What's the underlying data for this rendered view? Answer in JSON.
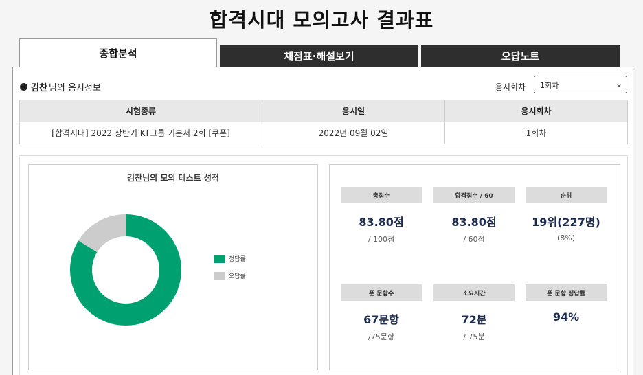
{
  "page_title": "합격시대 모의고사 결과표",
  "tabs": [
    {
      "label": "종합분석"
    },
    {
      "label": "채점표·해설보기"
    },
    {
      "label": "오답노트"
    }
  ],
  "user": {
    "name": "김찬",
    "suffix": "님의 응시정보"
  },
  "round_select": {
    "label": "응시회차",
    "selected": "1회차"
  },
  "info_table": {
    "headers": [
      "시험종류",
      "응시일",
      "응시회차"
    ],
    "row": [
      "[합격시대] 2022 상반기 KT그룹 기본서 2회 [쿠폰]",
      "2022년 09월 02일",
      "1회차"
    ]
  },
  "chart_data": {
    "type": "pie",
    "title": "김찬님의 모의 테스트 성적",
    "labels": [
      "정답률",
      "오답률"
    ],
    "values": [
      83.8,
      16.2
    ],
    "colors": [
      "#00a070",
      "#cccccc"
    ]
  },
  "cards": [
    {
      "header": "총점수",
      "value": "83.80점",
      "sub": "/ 100점"
    },
    {
      "header": "합격점수 / 60",
      "value": "83.80점",
      "sub": "/ 60점"
    },
    {
      "header": "순위",
      "value": "19위(227명)",
      "sub": "(8%)"
    },
    {
      "header": "푼 문항수",
      "value": "67문항",
      "sub": "/75문항"
    },
    {
      "header": "소요시간",
      "value": "72분",
      "sub": "/ 75분"
    },
    {
      "header": "푼 문항 정답률",
      "value": "94%",
      "sub": ""
    }
  ]
}
